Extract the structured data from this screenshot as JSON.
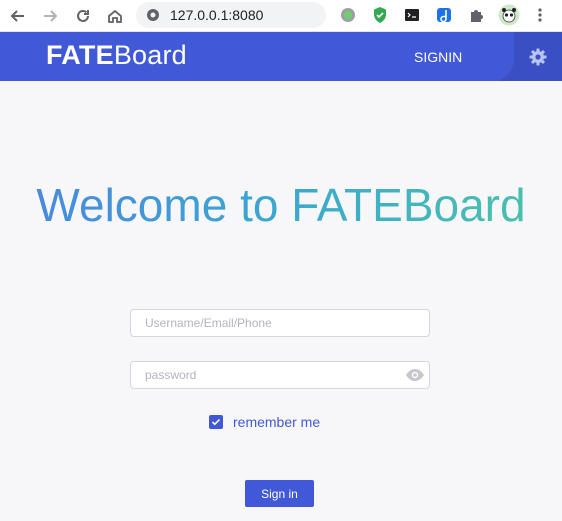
{
  "browser": {
    "url": "127.0.0.1:8080",
    "icons": [
      "back-arrow-icon",
      "forward-arrow-icon",
      "reload-icon",
      "home-icon",
      "site-info-icon",
      "extension-green-circle-icon",
      "extension-shield-icon",
      "extension-terminal-icon",
      "extension-d-icon",
      "puzzle-icon",
      "profile-avatar-icon",
      "more-menu-icon"
    ]
  },
  "header": {
    "logo_bold": "FATE",
    "logo_regular": "Board",
    "signin_label": "SIGNIN",
    "background": "#4159d6"
  },
  "main": {
    "welcome": "Welcome to FATEBoard",
    "username_placeholder": "Username/Email/Phone",
    "password_placeholder": "password",
    "remember_label": "remember me",
    "remember_checked": true,
    "signin_button": "Sign in"
  },
  "colors": {
    "accent": "#4159d6",
    "gradient_start": "#4a86e0",
    "gradient_end": "#4cc4a8"
  }
}
